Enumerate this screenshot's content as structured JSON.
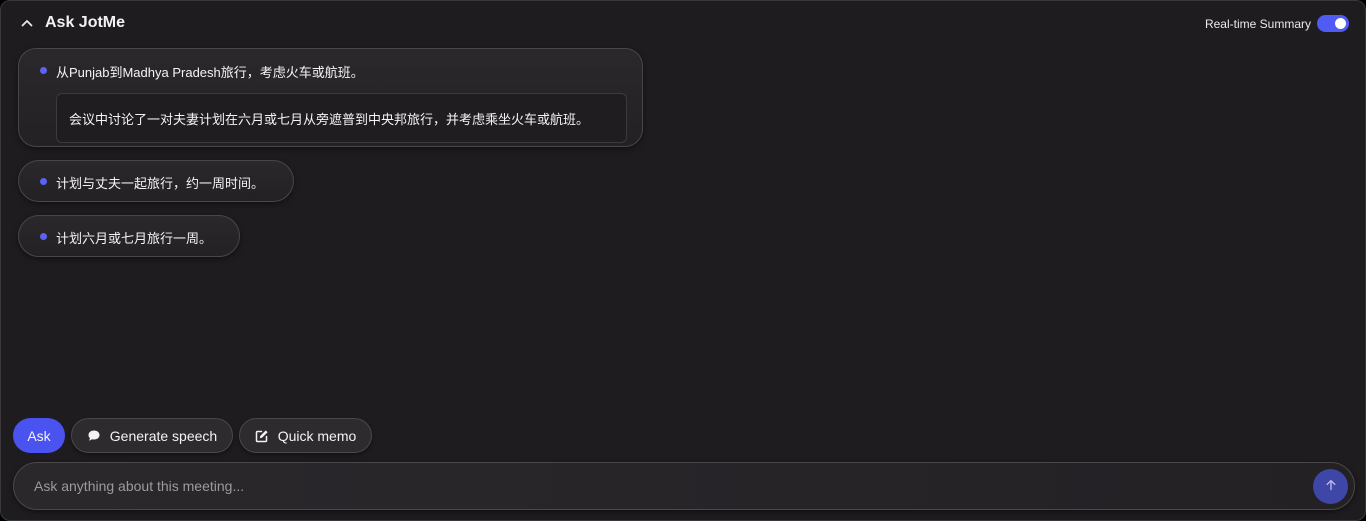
{
  "header": {
    "title": "Ask JotMe",
    "realtime_label": "Real-time Summary",
    "realtime_enabled": true
  },
  "summaries": [
    {
      "text": "从Punjab到Madhya Pradesh旅行，考虑火车或航班。",
      "detail": "会议中讨论了一对夫妻计划在六月或七月从旁遮普到中央邦旅行，并考虑乘坐火车或航班。"
    },
    {
      "text": "计划与丈夫一起旅行，约一周时间。"
    },
    {
      "text": "计划六月或七月旅行一周。"
    }
  ],
  "actions": {
    "ask_label": "Ask",
    "speech_label": "Generate speech",
    "memo_label": "Quick memo"
  },
  "input": {
    "placeholder": "Ask anything about this meeting..."
  },
  "icons": {
    "collapse": "chevron-up-icon",
    "speech": "chat-bubble-icon",
    "memo": "edit-icon",
    "send": "arrow-up-icon"
  },
  "colors": {
    "accent": "#4a52f0",
    "bullet": "#5b63f5",
    "background": "#1e1c1f"
  }
}
